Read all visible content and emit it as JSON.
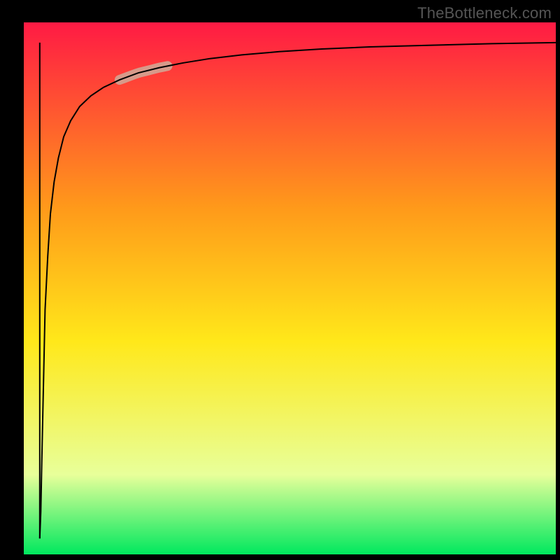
{
  "watermark": "TheBottleneck.com",
  "chart_data": {
    "type": "line",
    "title": "",
    "xlabel": "",
    "ylabel": "",
    "xlim": [
      0,
      1
    ],
    "ylim": [
      0,
      1
    ],
    "grid": false,
    "legend": false,
    "gradient_colors": [
      "#ff1a44",
      "#ff9a1a",
      "#ffe81a",
      "#e8ff9a",
      "#00e85e"
    ],
    "curve_color": "#000000",
    "highlight": {
      "color": "#d79a8a",
      "t_start": 0.18,
      "t_end": 0.27
    },
    "series": [
      {
        "name": "bottleneck-curve",
        "note": "curve reconstructed from pixels; values are fractions of plot area (0..1 each axis, origin bottom-left)",
        "x": [
          0.03,
          0.032,
          0.034,
          0.037,
          0.04,
          0.045,
          0.05,
          0.057,
          0.065,
          0.075,
          0.088,
          0.105,
          0.126,
          0.15,
          0.18,
          0.215,
          0.255,
          0.3,
          0.35,
          0.41,
          0.48,
          0.56,
          0.65,
          0.76,
          0.88,
          1.0
        ],
        "y": [
          0.03,
          0.08,
          0.18,
          0.32,
          0.46,
          0.56,
          0.64,
          0.7,
          0.745,
          0.785,
          0.815,
          0.842,
          0.862,
          0.878,
          0.892,
          0.905,
          0.915,
          0.924,
          0.932,
          0.939,
          0.945,
          0.95,
          0.954,
          0.957,
          0.96,
          0.962
        ]
      },
      {
        "name": "left-vertical-edge",
        "x": [
          0.03,
          0.03
        ],
        "y": [
          0.03,
          0.962
        ]
      }
    ]
  }
}
